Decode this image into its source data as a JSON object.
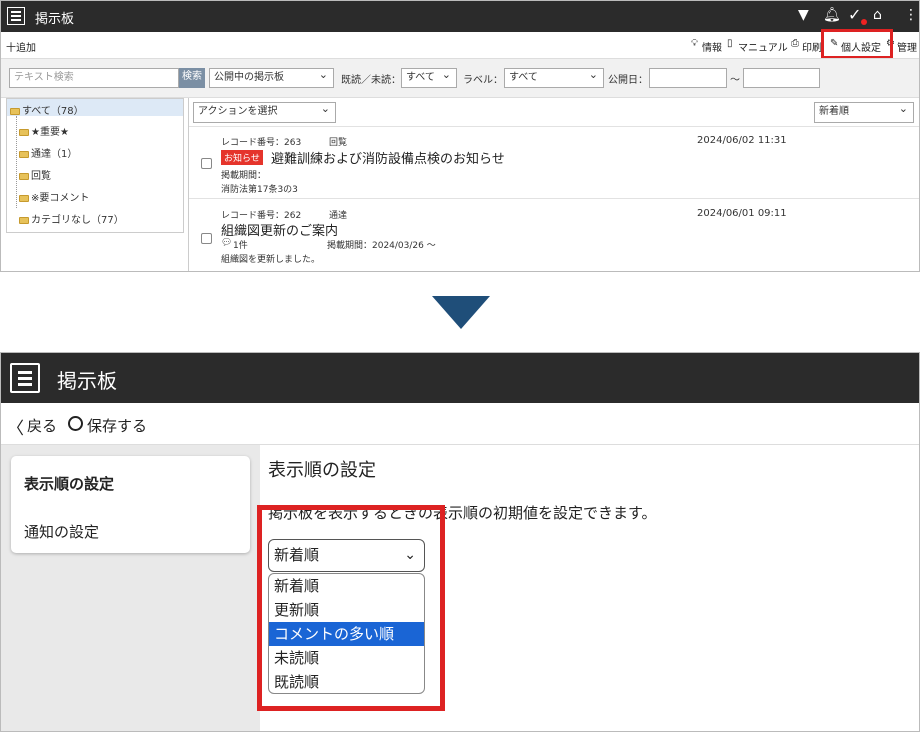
{
  "top": {
    "header": {
      "title": "掲示板"
    },
    "toolbar": {
      "add": "十追加",
      "info": "情報",
      "manual": "マニュアル",
      "print": "印刷",
      "personal": "個人設定",
      "manage": "管理"
    },
    "filter": {
      "search_placeholder": "テキスト検索",
      "search_button": "検索",
      "board_select": "公開中の掲示板",
      "read_label": "既読／未読：",
      "read_select": "すべて",
      "label_label": "ラベル：",
      "label_select": "すべて",
      "date_label": "公開日：",
      "tilde": "～"
    },
    "sidebar": {
      "items": [
        {
          "label": "すべて（78）"
        },
        {
          "label": "★重要★"
        },
        {
          "label": "通達（1）"
        },
        {
          "label": "回覧"
        },
        {
          "label": "※要コメント"
        },
        {
          "label": "カテゴリなし（77）"
        }
      ]
    },
    "main": {
      "action_select": "アクションを選択",
      "sort_select": "新着順",
      "records": [
        {
          "record_no": "レコード番号：263",
          "category": "回覧",
          "badge": "お知らせ",
          "title": "避難訓練および消防設備点検のお知らせ",
          "period": "掲載期間：",
          "extra": "消防法第17条3の3",
          "datetime": "2024/06/02 11:31"
        },
        {
          "record_no": "レコード番号：262",
          "category": "通達",
          "title": "組織図更新のご案内",
          "comments": "1件",
          "period": "掲載期間：2024/03/26 ～",
          "extra": "組織図を更新しました。",
          "datetime": "2024/06/01 09:11"
        }
      ]
    }
  },
  "bottom": {
    "header": {
      "title": "掲示板"
    },
    "toolbar": {
      "back": "戻る",
      "save": "保存する"
    },
    "nav": {
      "items": [
        "表示順の設定",
        "通知の設定"
      ]
    },
    "panel": {
      "heading": "表示順の設定",
      "description": "掲示板を表示するときの表示順の初期値を設定できます。",
      "select_value": "新着順",
      "options": [
        "新着順",
        "更新順",
        "コメントの多い順",
        "未読順",
        "既読順"
      ],
      "highlighted_option": "コメントの多い順"
    }
  },
  "colors": {
    "header_bg": "#2b2b2b",
    "highlight_red": "#d22222",
    "arrow": "#1f4e79",
    "option_highlight": "#1a65d5",
    "badge": "#e5342b"
  }
}
